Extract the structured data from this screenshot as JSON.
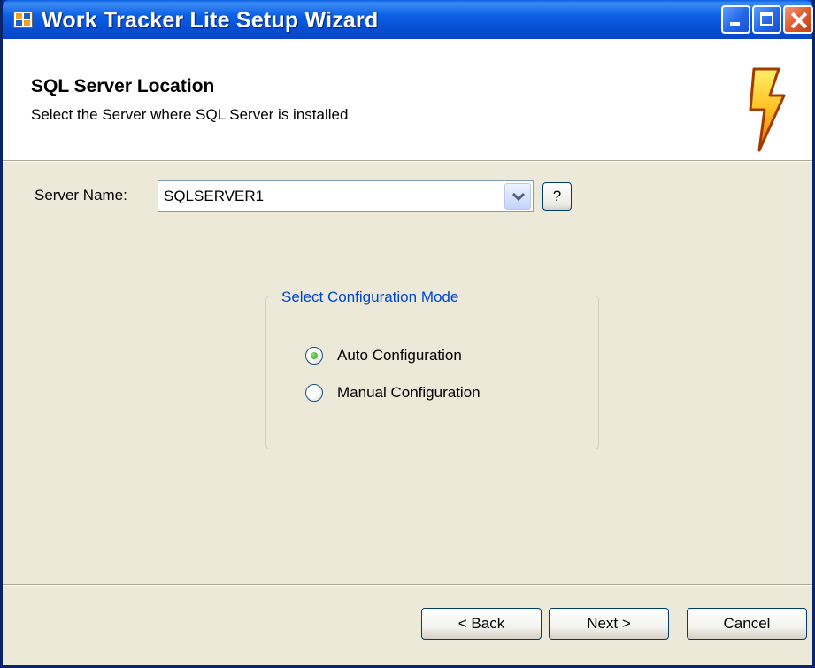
{
  "window": {
    "title": "Work Tracker Lite Setup Wizard"
  },
  "header": {
    "title": "SQL Server Location",
    "subtitle": "Select the Server where SQL Server is installed"
  },
  "form": {
    "server_label": "Server Name:",
    "server_value": "SQLSERVER1",
    "help_label": "?"
  },
  "config": {
    "legend": "Select Configuration Mode",
    "options": [
      {
        "label": "Auto Configuration",
        "checked": true
      },
      {
        "label": "Manual Configuration",
        "checked": false
      }
    ]
  },
  "buttons": {
    "back": "< Back",
    "next": "Next >",
    "cancel": "Cancel"
  },
  "colors": {
    "titlebar": "#0a5fe0",
    "dialog_bg": "#ece9d8",
    "group_legend": "#0046d5"
  }
}
